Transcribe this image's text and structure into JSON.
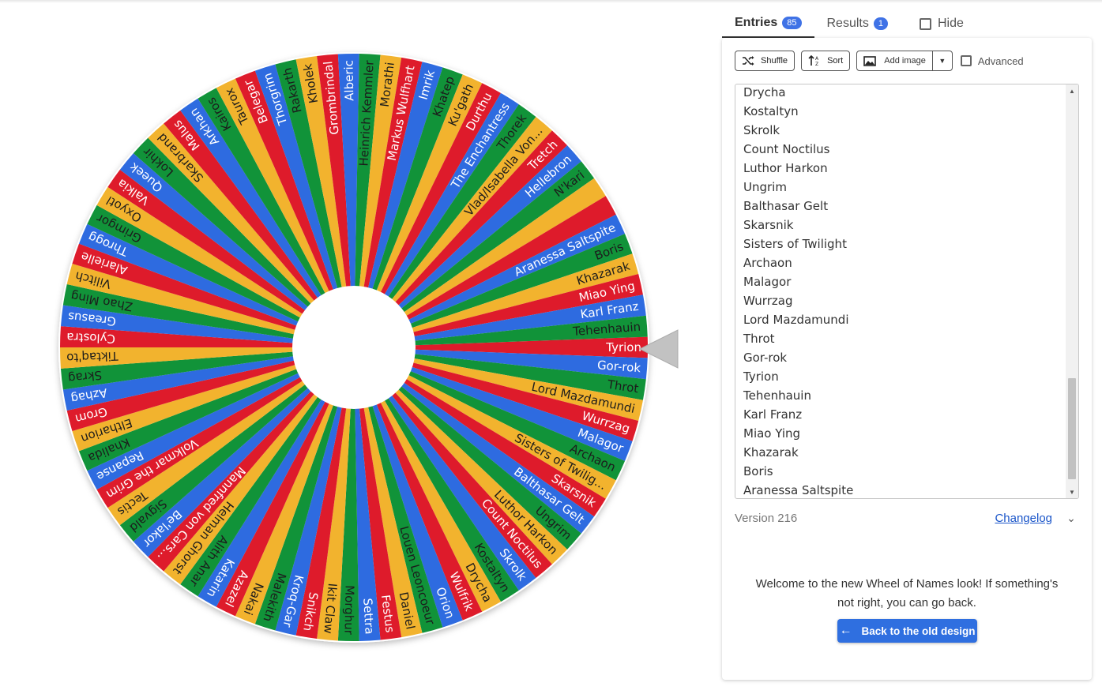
{
  "tabs": {
    "entries_label": "Entries",
    "entries_count": "85",
    "results_label": "Results",
    "results_count": "1",
    "hide_label": "Hide"
  },
  "toolbar": {
    "shuffle_label": "Shuffle",
    "sort_label": "Sort",
    "add_image_label": "Add image",
    "advanced_label": "Advanced"
  },
  "entries": [
    "Drycha",
    "Kostaltyn",
    "Skrolk",
    "Count Noctilus",
    "Luthor Harkon",
    "Ungrim",
    "Balthasar Gelt",
    "Skarsnik",
    "Sisters of Twilight",
    "Archaon",
    "Malagor",
    "Wurrzag",
    "Lord Mazdamundi",
    "Throt",
    "Gor-rok",
    "Tyrion",
    "Tehenhauin",
    "Karl Franz",
    "Miao Ying",
    "Khazarak",
    "Boris",
    "Aranessa Saltspite"
  ],
  "footer": {
    "version": "Version 216",
    "changelog": "Changelog"
  },
  "welcome": {
    "text": "Welcome to the new Wheel of Names look! If something's not right, you can go back.",
    "back_button": "Back to the old design"
  },
  "wheel": {
    "colors": [
      "#de1b2b",
      "#2e6be0",
      "#119339",
      "#f2b32e"
    ],
    "labels_clockwise_from_pointer": [
      "Tyrion",
      "Gor-rok",
      "Throt",
      "Lord Mazdamundi",
      "Wurrzag",
      "Malagor",
      "Archaon",
      "Sisters of Twilig...",
      "Skarsnik",
      "Balthasar Gelt",
      "Ungrim",
      "Luthor Harkon",
      "Count Noctilus",
      "Skrolk",
      "Kostaltyn",
      "Drycha",
      "Wulfrik",
      "Orion",
      "Louen Leoncoeur",
      "Daniel",
      "Festus",
      "Settra",
      "Morghur",
      "Ikit Claw",
      "Snikch",
      "Kroq-Gar",
      "Malekith",
      "Nakai",
      "Azazel",
      "Katarin",
      "Alith Anar",
      "Helman Ghorst",
      "Mannfred von Cars...",
      "Be'lakor",
      "Sigvald",
      "Tectis",
      "Volkmar the Grim",
      "Repanse",
      "Khalida",
      "Eltharion",
      "Grom",
      "Azhag",
      "Skrag",
      "Tiktaq'to",
      "Cylostra",
      "Greasus",
      "Zhao Ming",
      "Vilitch",
      "Alarielle",
      "Throgg",
      "Grimgor",
      "Oxyotl",
      "Valkia",
      "Queek",
      "Lokhir",
      "Skarbrand",
      "Malus",
      "Arkhan",
      "Kairos",
      "Taurox",
      "Belegar",
      "Thorgrim",
      "Rakarth",
      "Kholek",
      "Grombrindal",
      "Alberic",
      "Heinrich Kemmler",
      "Morathi",
      "Markus Wulfhart",
      "Imrik",
      "Khatep",
      "Ku'gath",
      "Durthu",
      "The Enchantress",
      "Thorek",
      "Vlad/Isabella Von...",
      "Tretch",
      "Hellebron",
      "N'kari",
      "",
      "",
      "Aranessa Saltspite",
      "Boris",
      "Khazarak",
      "Miao Ying",
      "Karl Franz",
      "Tehenhauin"
    ],
    "text_colors": [
      "#ffffff",
      "#ffffff",
      "#1c1c1c",
      "#1c1c1c"
    ]
  }
}
